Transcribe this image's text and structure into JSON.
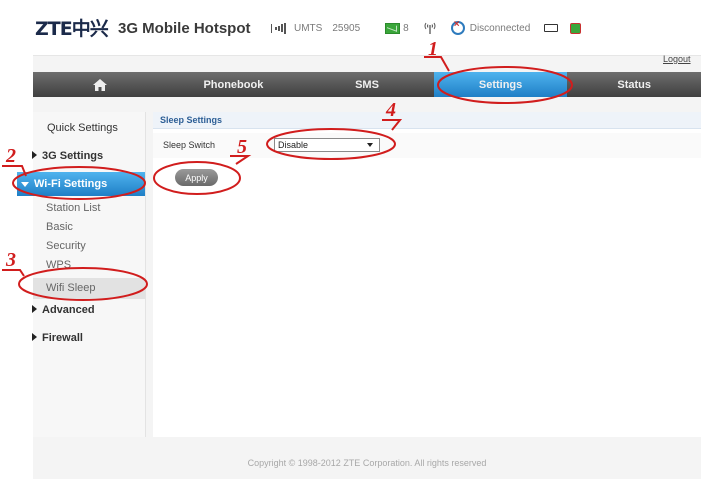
{
  "header": {
    "logo": "ZTE中兴",
    "title": "3G Mobile Hotspot",
    "network": "UMTS",
    "operator": "25905",
    "sms_count": "8",
    "connection": "Disconnected",
    "logout": "Logout"
  },
  "nav": {
    "home_icon": "home-icon",
    "items": [
      {
        "label": "Phonebook"
      },
      {
        "label": "SMS"
      },
      {
        "label": "Settings"
      },
      {
        "label": "Status"
      }
    ]
  },
  "sidebar": {
    "quick_settings": "Quick Settings",
    "g3_settings": "3G Settings",
    "wifi_settings": "Wi-Fi Settings",
    "wifi_sub": [
      {
        "label": "Station List"
      },
      {
        "label": "Basic"
      },
      {
        "label": "Security"
      },
      {
        "label": "WPS"
      },
      {
        "label": "Wifi Sleep"
      }
    ],
    "advanced": "Advanced",
    "firewall": "Firewall"
  },
  "content": {
    "panel_title": "Sleep Settings",
    "sleep_switch_label": "Sleep Switch",
    "sleep_switch_value": "Disable",
    "apply_label": "Apply"
  },
  "footer": {
    "copyright": "Copyright © 1998-2012 ZTE Corporation. All rights reserved"
  },
  "annotations": {
    "numbers": [
      "1",
      "2",
      "3",
      "4",
      "5"
    ],
    "color": "#d11d1d"
  },
  "colors": {
    "active_blue": "#1f7fc6",
    "nav_gray": "#4f4f4f",
    "annotation_red": "#d11d1d"
  }
}
